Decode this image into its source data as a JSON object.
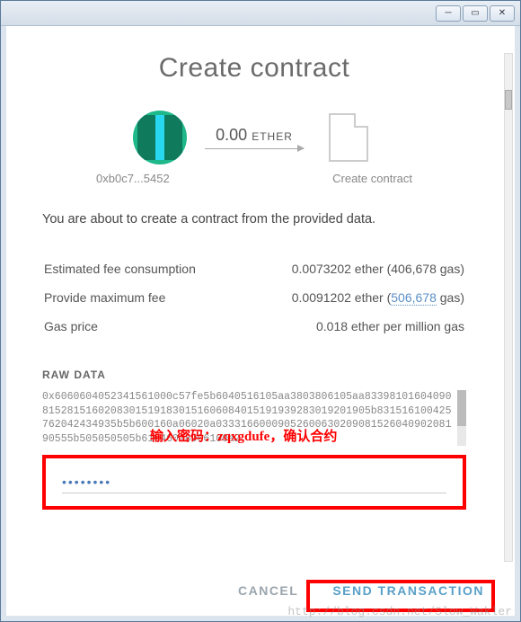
{
  "title": "Create contract",
  "from": {
    "address": "0xb0c7...5452"
  },
  "to": {
    "label": "Create contract"
  },
  "amount": {
    "value": "0.00",
    "unit": "ETHER"
  },
  "notice": "You are about to create a contract from the provided data.",
  "fees": {
    "estimated_label": "Estimated fee consumption",
    "estimated_value": "0.0073202 ether (406,678 gas)",
    "max_label": "Provide maximum fee",
    "max_value_prefix": "0.0091202 ether (",
    "max_gas": "506,678",
    "max_value_suffix": " gas)",
    "price_label": "Gas price",
    "price_value": "0.018 ether per million gas"
  },
  "raw": {
    "label": "RAW DATA",
    "text": "0x6060604052341561000c57fe5b6040516105aa3803806105aa833981016040908152815160208301519183015160608401519193928301920190​5b831516100425762042434935b5b600160a06020a033316600090​5260063020908152604090208190555b505050505b61046018906100a2"
  },
  "password": {
    "masked": "••••••••"
  },
  "annotation": "输入密码：zqxgdufe，确认合约",
  "buttons": {
    "cancel": "CANCEL",
    "send": "SEND TRANSACTION"
  },
  "watermark": "http://blog.csdn.net/Slow_Wakler"
}
